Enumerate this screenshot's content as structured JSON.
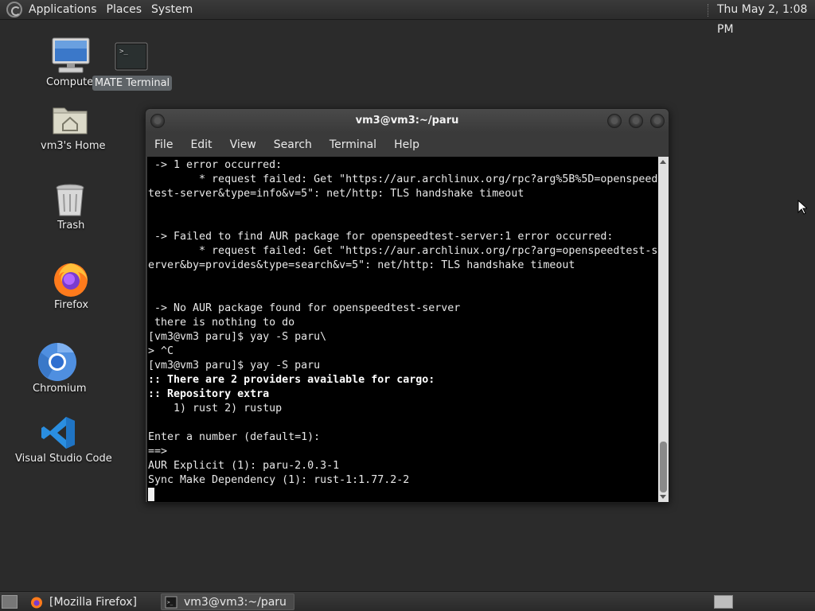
{
  "top_panel": {
    "menus": [
      "Applications",
      "Places",
      "System"
    ],
    "clock": "Thu May  2,  1:08 PM"
  },
  "desktop": {
    "icons": [
      {
        "label": "Computer",
        "icon": "computer-icon"
      },
      {
        "label": "MATE Terminal",
        "icon": "terminal-icon"
      },
      {
        "label": "vm3's Home",
        "icon": "home-folder-icon"
      },
      {
        "label": "Trash",
        "icon": "trash-icon"
      },
      {
        "label": "Firefox",
        "icon": "firefox-icon"
      },
      {
        "label": "Chromium",
        "icon": "chromium-icon"
      },
      {
        "label": "Visual Studio Code",
        "icon": "vscode-icon"
      }
    ]
  },
  "window": {
    "title": "vm3@vm3:~/paru",
    "menu": [
      "File",
      "Edit",
      "View",
      "Search",
      "Terminal",
      "Help"
    ],
    "lines": [
      {
        "text": " -> 1 error occurred:",
        "bold": false
      },
      {
        "text": "        * request failed: Get \"https://aur.archlinux.org/rpc?arg%5B%5D=openspeed",
        "bold": false
      },
      {
        "text": "test-server&type=info&v=5\": net/http: TLS handshake timeout",
        "bold": false
      },
      {
        "text": "",
        "bold": false
      },
      {
        "text": "",
        "bold": false
      },
      {
        "text": " -> Failed to find AUR package for openspeedtest-server:1 error occurred:",
        "bold": false
      },
      {
        "text": "        * request failed: Get \"https://aur.archlinux.org/rpc?arg=openspeedtest-s",
        "bold": false
      },
      {
        "text": "erver&by=provides&type=search&v=5\": net/http: TLS handshake timeout",
        "bold": false
      },
      {
        "text": "",
        "bold": false
      },
      {
        "text": "",
        "bold": false
      },
      {
        "text": " -> No AUR package found for openspeedtest-server",
        "bold": false
      },
      {
        "text": " there is nothing to do",
        "bold": false
      },
      {
        "text": "[vm3@vm3 paru]$ yay -S paru\\",
        "bold": false
      },
      {
        "text": "> ^C",
        "bold": false
      },
      {
        "text": "[vm3@vm3 paru]$ yay -S paru",
        "bold": false
      },
      {
        "text": ":: There are 2 providers available for cargo:",
        "bold": true
      },
      {
        "text": ":: Repository extra",
        "bold": true
      },
      {
        "text": "    1) rust 2) rustup",
        "bold": false
      },
      {
        "text": "",
        "bold": false
      },
      {
        "text": "Enter a number (default=1):",
        "bold": false
      },
      {
        "text": "==>",
        "bold": false
      },
      {
        "text": "AUR Explicit (1): paru-2.0.3-1",
        "bold": false
      },
      {
        "text": "Sync Make Dependency (1): rust-1:1.77.2-2",
        "bold": false
      }
    ]
  },
  "taskbar": {
    "tasks": [
      {
        "label": "[Mozilla Firefox]",
        "icon": "firefox-icon",
        "active": false
      },
      {
        "label": "vm3@vm3:~/paru",
        "icon": "terminal-icon",
        "active": true
      }
    ]
  }
}
